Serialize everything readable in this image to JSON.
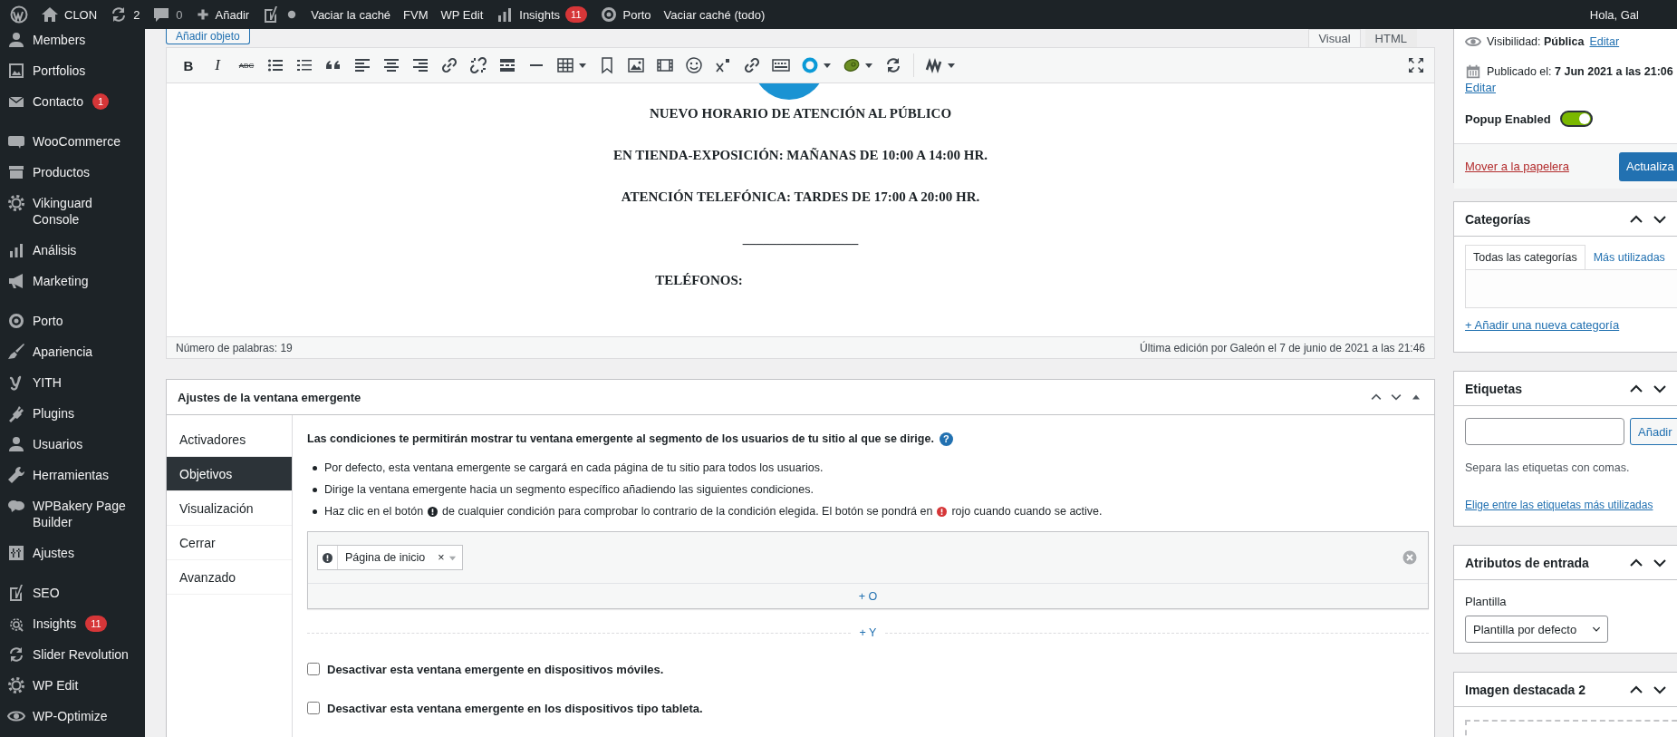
{
  "admin_bar": {
    "site": "CLON",
    "updates": "2",
    "comments": "0",
    "new": "Añadir",
    "links": [
      "Vaciar la caché",
      "FVM",
      "WP Edit"
    ],
    "insights": {
      "label": "Insights",
      "count": "11"
    },
    "porto": "Porto",
    "purge": "Vaciar caché (todo)",
    "greeting": "Hola, Gal"
  },
  "sidebar": {
    "groups": [
      {
        "items": [
          {
            "label": "Members"
          },
          {
            "label": "Portfolios"
          },
          {
            "label": "Contacto",
            "badge": "1"
          }
        ]
      },
      {
        "items": [
          {
            "label": "WooCommerce"
          },
          {
            "label": "Productos"
          },
          {
            "label": "Vikinguard Console"
          },
          {
            "label": "Análisis"
          },
          {
            "label": "Marketing"
          }
        ]
      },
      {
        "items": [
          {
            "label": "Porto"
          },
          {
            "label": "Apariencia"
          },
          {
            "label": "YITH"
          },
          {
            "label": "Plugins"
          },
          {
            "label": "Usuarios"
          },
          {
            "label": "Herramientas"
          },
          {
            "label": "WPBakery Page Builder"
          },
          {
            "label": "Ajustes"
          }
        ]
      },
      {
        "items": [
          {
            "label": "SEO"
          },
          {
            "label": "Insights",
            "badge": "11"
          },
          {
            "label": "Slider Revolution"
          },
          {
            "label": "WP Edit"
          },
          {
            "label": "WP-Optimize"
          }
        ]
      }
    ]
  },
  "editor": {
    "add_media": "Añadir objeto",
    "tabs": [
      {
        "label": "Visual",
        "selected": true
      },
      {
        "label": "HTML",
        "selected": false
      }
    ],
    "format_buttons": [
      "B",
      "I",
      "ABC"
    ],
    "content": [
      "NUEVO HORARIO DE ATENCIÓN AL PÚBLICO",
      "EN TIENDA-EXPOSICIÓN: MAÑANAS DE 10:00 A 14:00 HR.",
      "ATENCIÓN TELEFÓNICA: TARDES DE 17:00 A 20:00 HR.",
      "_________________",
      "TELÉFONOS:"
    ],
    "word_count": "Número de palabras: 19",
    "last_edit": "Última edición por Galeón el 7 de junio de 2021 a las 21:46"
  },
  "popup_settings": {
    "title": "Ajustes de la ventana emergente",
    "tabs": [
      {
        "label": "Activadores",
        "selected": false
      },
      {
        "label": "Objetivos",
        "selected": true
      },
      {
        "label": "Visualización",
        "selected": false
      },
      {
        "label": "Cerrar",
        "selected": false
      },
      {
        "label": "Avanzado",
        "selected": false
      }
    ],
    "intro": "Las condiciones te permitirán mostrar tu ventana emergente al segmento de los usuarios de tu sitio al que se dirige.",
    "help": "?",
    "bullets": [
      {
        "parts": [
          "Por defecto, esta ventana emergente se cargará en cada página de tu sitio para todos los usuarios."
        ]
      },
      {
        "parts": [
          "Dirige la ventana emergente hacia un segmento específico añadiendo las siguientes condiciones."
        ]
      },
      {
        "parts": [
          "Haz clic en el botón",
          "de cualquier condición para comprobar lo contrario de la condición elegida. El botón se pondrá en",
          "rojo cuando cuando se active."
        ]
      }
    ],
    "condition": {
      "label": "Página de inicio",
      "remove": "×"
    },
    "or_label": "+ O",
    "and_label": "+ Y",
    "checkboxes": [
      {
        "label": "Desactivar esta ventana emergente en dispositivos móviles.",
        "checked": false
      },
      {
        "label": "Desactivar esta ventana emergente en los dispositivos tipo tableta.",
        "checked": false
      }
    ]
  },
  "publish": {
    "visibility_label": "Visibilidad:",
    "visibility": "Pública",
    "visibility_edit": "Editar",
    "published_label": "Publicado el:",
    "published": "7 Jun 2021 a las 21:06",
    "published_edit": "Editar",
    "popup_enabled": {
      "label": "Popup Enabled",
      "on": true
    },
    "trash": "Mover a la papelera",
    "update": "Actualiza"
  },
  "categories": {
    "title": "Categorías",
    "tabs": [
      {
        "label": "Todas las categorías",
        "selected": true
      },
      {
        "label": "Más utilizadas",
        "selected": false
      }
    ],
    "add_link": "+ Añadir una nueva categoría"
  },
  "tags": {
    "title": "Etiquetas",
    "button": "Añadir",
    "hint": "Separa las etiquetas con comas.",
    "link": "Elige entre las etiquetas más utilizadas"
  },
  "attributes": {
    "title": "Atributos de entrada",
    "template_label": "Plantilla",
    "template": "Plantilla por defecto"
  },
  "featured_image": {
    "title": "Imagen destacada 2"
  }
}
